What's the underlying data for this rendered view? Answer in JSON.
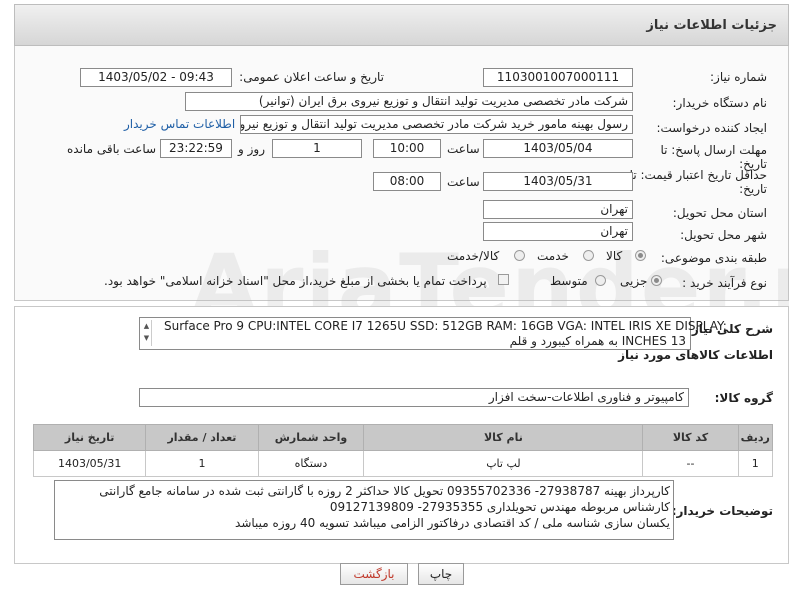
{
  "header": {
    "title": "جزئیات اطلاعات نیاز"
  },
  "fields": {
    "need_number_label": "شماره نیاز:",
    "need_number": "1103001007000111",
    "announce_label": "تاریخ و ساعت اعلان عمومی:",
    "announce_value": "1403/05/02 - 09:43",
    "buyer_label": "نام دستگاه خریدار:",
    "buyer_value": "شرکت مادر تخصصی مدیریت تولید  انتقال و توزیع نیروی برق ایران (توانیر)",
    "creator_label": "ایجاد کننده درخواست:",
    "creator_value": "رسول بهینه مامور خرید شرکت مادر تخصصی مدیریت تولید  انتقال و توزیع نیروی",
    "contact_link": "اطلاعات تماس خریدار",
    "deadline_label": "مهلت ارسال پاسخ: تا",
    "deadline_label2": "تاریخ:",
    "deadline_date": "1403/05/04",
    "time_label": "ساعت",
    "deadline_time": "10:00",
    "days_value": "1",
    "days_label": "روز و",
    "remaining_value": "23:22:59",
    "remaining_label": "ساعت باقی مانده",
    "validity_label": "حداقل تاریخ اعتبار قیمت: تا",
    "validity_label2": "تاریخ:",
    "validity_date": "1403/05/31",
    "validity_time": "08:00",
    "province_label": "استان محل تحویل:",
    "province_value": "تهران",
    "city_label": "شهر محل تحویل:",
    "city_value": "تهران",
    "category_label": "طبقه بندی موضوعی:",
    "category_options": [
      "کالا",
      "خدمت",
      "کالا/خدمت"
    ],
    "process_label": "نوع فرآیند خرید :",
    "process_options": [
      "جزیی",
      "متوسط"
    ],
    "process_note": "پرداخت تمام یا بخشی از مبلغ خرید،از محل \"اسناد خزانه اسلامی\" خواهد بود."
  },
  "description": {
    "label": "شرح کلی نیاز:",
    "line1": "Surface Pro 9  CPU:INTEL CORE I7 1265U  SSD: 512GB RAM: 16GB VGA: INTEL IRIS XE DISPLAY:",
    "line2": "13 INCHES                به همراه کیبورد و قلم"
  },
  "goods_info": {
    "title": "اطلاعات کالاهای مورد نیاز",
    "group_label": "گروه کالا:",
    "group_value": "کامپیوتر و فناوری اطلاعات-سخت افزار"
  },
  "table": {
    "headers": [
      "ردیف",
      "کد کالا",
      "نام کالا",
      "واحد شمارش",
      "تعداد / مقدار",
      "تاریخ نیاز"
    ],
    "rows": [
      [
        "1",
        "--",
        "لپ تاپ",
        "دستگاه",
        "1",
        "1403/05/31"
      ]
    ]
  },
  "buyer_notes": {
    "label": "توضیحات خریدار:",
    "line1": "کارپرداز بهینه 27938787-  09355702336   تحویل کالا حداکثر 2 روزه     با گارانتی ثبت شده در سامانه جامع گارانتی",
    "line2": "کارشناس مربوطه مهندس تحویلداری 27935355- 09127139809",
    "line3": "یکسان سازی شناسه ملی / کد اقتصادی درفاکتور الزامی میباشد     تسویه 40 روزه میباشد"
  },
  "buttons": {
    "print": "چاپ",
    "back": "بازگشت"
  },
  "watermark": "AriaTender.neT"
}
